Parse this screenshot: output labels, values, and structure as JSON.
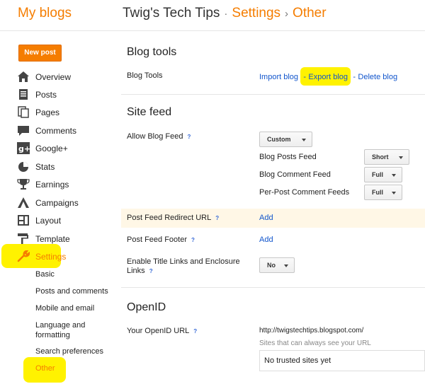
{
  "header": {
    "my_blogs": "My blogs",
    "blog_name": "Twig's Tech Tips",
    "sep1": "·",
    "section": "Settings",
    "sep2": "›",
    "page": "Other"
  },
  "new_post": "New post",
  "sidebar": {
    "items": [
      {
        "label": "Overview",
        "icon": "home-icon"
      },
      {
        "label": "Posts",
        "icon": "posts-icon"
      },
      {
        "label": "Pages",
        "icon": "pages-icon"
      },
      {
        "label": "Comments",
        "icon": "comments-icon"
      },
      {
        "label": "Google+",
        "icon": "google-plus-icon"
      },
      {
        "label": "Stats",
        "icon": "stats-icon"
      },
      {
        "label": "Earnings",
        "icon": "trophy-icon"
      },
      {
        "label": "Campaigns",
        "icon": "campaigns-icon"
      },
      {
        "label": "Layout",
        "icon": "layout-icon"
      },
      {
        "label": "Template",
        "icon": "template-icon"
      },
      {
        "label": "Settings",
        "icon": "wrench-icon"
      }
    ],
    "sub_items": [
      {
        "label": "Basic"
      },
      {
        "label": "Posts and comments"
      },
      {
        "label": "Mobile and email"
      },
      {
        "label": "Language and formatting"
      },
      {
        "label": "Search preferences"
      },
      {
        "label": "Other"
      }
    ]
  },
  "blog_tools": {
    "title": "Blog tools",
    "label": "Blog Tools",
    "import": "Import blog",
    "dash1": "-",
    "export": "Export blog",
    "dash2": "-",
    "delete": "Delete blog"
  },
  "site_feed": {
    "title": "Site feed",
    "allow_label": "Allow Blog Feed",
    "allow_value": "Custom",
    "posts_feed_label": "Blog Posts Feed",
    "posts_feed_value": "Short",
    "comment_feed_label": "Blog Comment Feed",
    "comment_feed_value": "Full",
    "per_post_label": "Per-Post Comment Feeds",
    "per_post_value": "Full",
    "redirect_label": "Post Feed Redirect URL",
    "redirect_action": "Add",
    "footer_label": "Post Feed Footer",
    "footer_action": "Add",
    "title_links_label": "Enable Title Links and Enclosure Links",
    "title_links_value": "No",
    "help": "?"
  },
  "openid": {
    "title": "OpenID",
    "url_label": "Your OpenID URL",
    "url_value": "http://twigstechtips.blogspot.com/",
    "sites_note": "Sites that can always see your URL",
    "trusted": "No trusted sites yet"
  },
  "colors": {
    "accent": "#f57d00",
    "link": "#1155cc",
    "highlight": "#fff200"
  }
}
